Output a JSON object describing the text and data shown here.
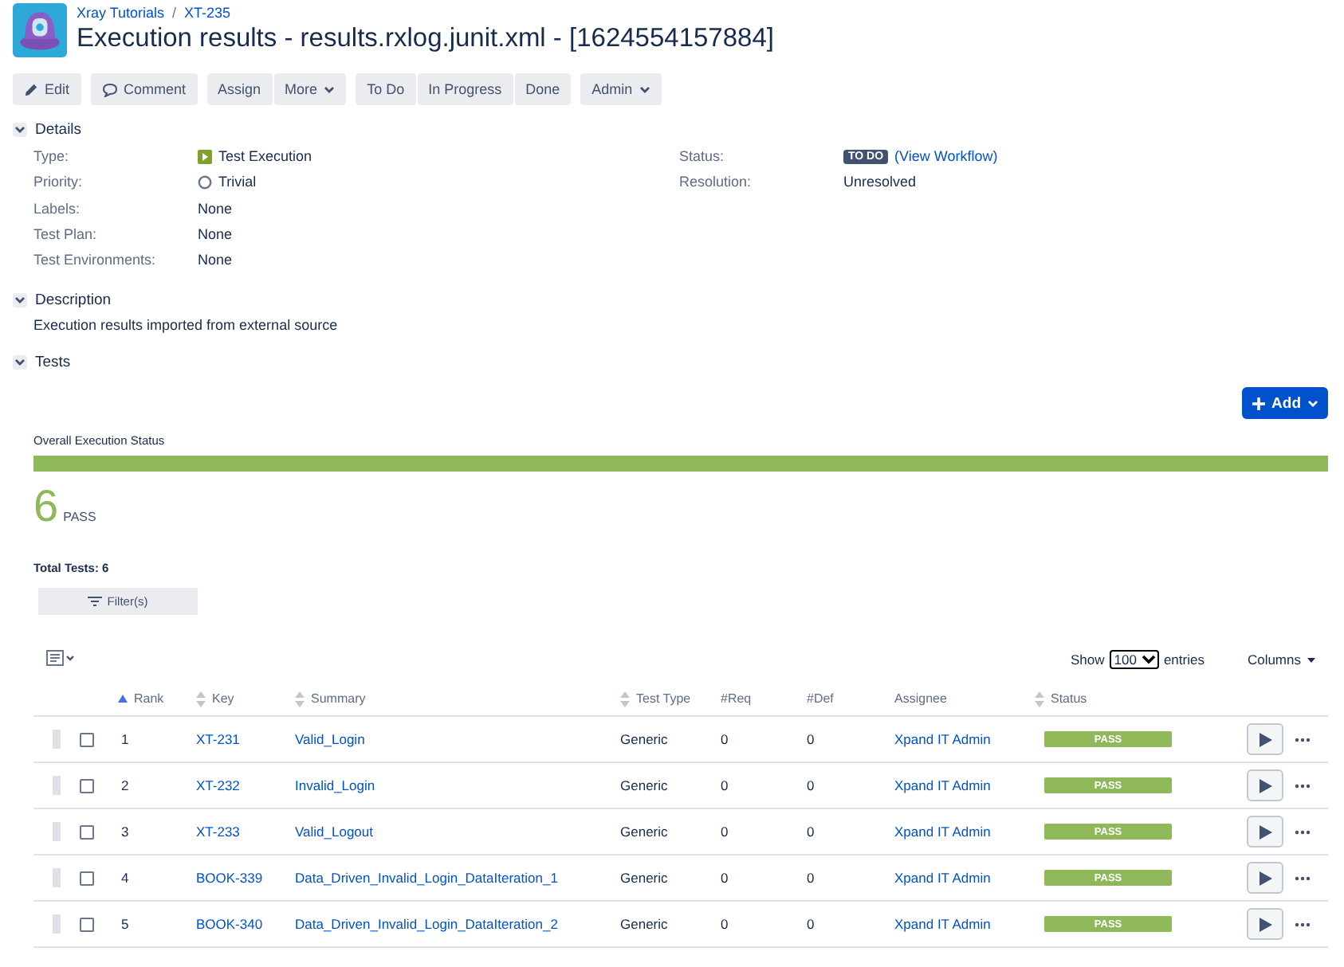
{
  "breadcrumbs": [
    "Xray Tutorials",
    "XT-235"
  ],
  "breadcrumb_separator": "/",
  "title": "Execution results - results.rxlog.junit.xml - [1624554157884]",
  "toolbar": [
    [
      {
        "label": "Edit",
        "kind": "edit"
      }
    ],
    [
      {
        "label": "Comment",
        "kind": "comment"
      }
    ],
    [
      {
        "label": "Assign",
        "kind": "plain"
      },
      {
        "label": "More",
        "kind": "dropdown"
      }
    ],
    [
      {
        "label": "To Do",
        "kind": "plain"
      },
      {
        "label": "In Progress",
        "kind": "plain"
      },
      {
        "label": "Done",
        "kind": "plain"
      }
    ],
    [
      {
        "label": "Admin",
        "kind": "dropdown"
      }
    ]
  ],
  "details": {
    "title": "Details",
    "expanded": true,
    "left": [
      {
        "label": "Type:",
        "value": "Test Execution",
        "kind": "type"
      },
      {
        "label": "Priority:",
        "value": "Trivial",
        "kind": "priority"
      },
      {
        "label": "Labels:",
        "value": "None",
        "kind": "plain"
      },
      {
        "label": "Test Plan:",
        "value": "None",
        "kind": "plain"
      },
      {
        "label": "Test Environments:",
        "value": "None",
        "kind": "plain"
      }
    ],
    "right": [
      {
        "label": "Status:",
        "badge": "TO DO",
        "link": "(View Workflow)",
        "kind": "status"
      },
      {
        "label": "Resolution:",
        "value": "Unresolved",
        "kind": "plain"
      }
    ]
  },
  "description": {
    "title": "Description",
    "expanded": true,
    "text": "Execution results imported from external source"
  },
  "tests": {
    "title": "Tests",
    "expanded": true,
    "add_button": "Add",
    "overall_title": "Overall Execution Status",
    "bar": [
      {
        "kind": "pass",
        "level": 1
      }
    ],
    "count": "6",
    "count_label": "PASS",
    "total": "Total Tests: 6",
    "filter_button": "Filter(s)",
    "show_label": "Show",
    "page_size": "100",
    "entries_label": "entries",
    "columns_button": "Columns",
    "columns": [
      {
        "label": "Rank",
        "kind": "sorted"
      },
      {
        "label": "Key",
        "kind": "sortable"
      },
      {
        "label": "Summary",
        "kind": "sortable"
      },
      {
        "label": "Test Type",
        "kind": "sortable"
      },
      {
        "label": "#Req",
        "kind": "plain"
      },
      {
        "label": "#Def",
        "kind": "plain"
      },
      {
        "label": "Assignee",
        "kind": "plain"
      },
      {
        "label": "Status",
        "kind": "sortable"
      }
    ],
    "rows": [
      {
        "checked": false,
        "rank": "1",
        "key": "XT-231",
        "summary": "Valid_Login",
        "test_type": "Generic",
        "req": "0",
        "def": "0",
        "assignee": "Xpand IT Admin",
        "status": "PASS",
        "kind": "pass"
      },
      {
        "checked": false,
        "rank": "2",
        "key": "XT-232",
        "summary": "Invalid_Login",
        "test_type": "Generic",
        "req": "0",
        "def": "0",
        "assignee": "Xpand IT Admin",
        "status": "PASS",
        "kind": "pass"
      },
      {
        "checked": false,
        "rank": "3",
        "key": "XT-233",
        "summary": "Valid_Logout",
        "test_type": "Generic",
        "req": "0",
        "def": "0",
        "assignee": "Xpand IT Admin",
        "status": "PASS",
        "kind": "pass"
      },
      {
        "checked": false,
        "rank": "4",
        "key": "BOOK-339",
        "summary": "Data_Driven_Invalid_Login_DataIteration_1",
        "test_type": "Generic",
        "req": "0",
        "def": "0",
        "assignee": "Xpand IT Admin",
        "status": "PASS",
        "kind": "pass"
      },
      {
        "checked": false,
        "rank": "5",
        "key": "BOOK-340",
        "summary": "Data_Driven_Invalid_Login_DataIteration_2",
        "test_type": "Generic",
        "req": "0",
        "def": "0",
        "assignee": "Xpand IT Admin",
        "status": "PASS",
        "kind": "pass"
      }
    ]
  }
}
